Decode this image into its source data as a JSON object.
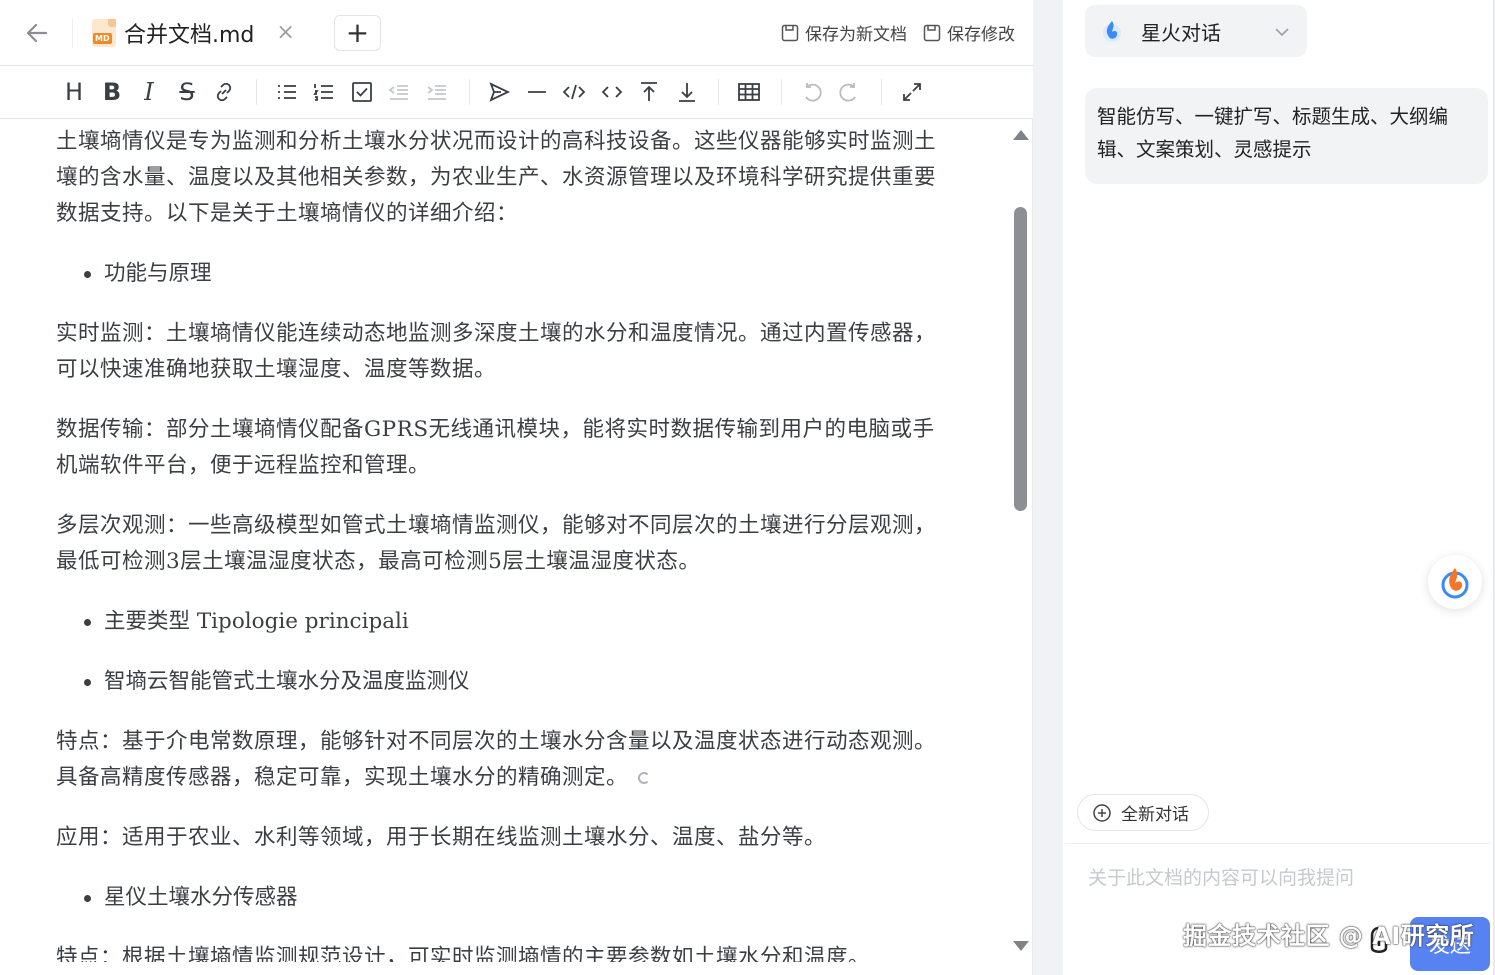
{
  "tabbar": {
    "file_name": "合并文档.md",
    "md_badge": "MD",
    "close_glyph": "×",
    "add_glyph": "+",
    "save_as_new": "保存为新文档",
    "save_changes": "保存修改"
  },
  "toolbar": {
    "heading": "H",
    "bold": "B",
    "italic": "I",
    "strike": "S",
    "buttons": [
      "heading",
      "bold",
      "italic",
      "strikethrough",
      "link",
      "unordered-list",
      "ordered-list",
      "task-list",
      "outdent",
      "indent",
      "quote",
      "horizontal-rule",
      "code-block",
      "inline-code",
      "to-top",
      "to-bottom",
      "table",
      "undo",
      "redo",
      "fullscreen"
    ]
  },
  "content": {
    "p1": "土壤墒情仪是专为监测和分析土壤水分状况而设计的高科技设备。这些仪器能够实时监测土壤的含水量、温度以及其他相关参数，为农业生产、水资源管理以及环境科学研究提供重要数据支持。以下是关于土壤墒情仪的详细介绍：",
    "b1": "功能与原理",
    "p2": "实时监测：土壤墒情仪能连续动态地监测多深度土壤的水分和温度情况。通过内置传感器，可以快速准确地获取土壤湿度、温度等数据。",
    "p3": "数据传输：部分土壤墒情仪配备GPRS无线通讯模块，能将实时数据传输到用户的电脑或手机端软件平台，便于远程监控和管理。",
    "p4": "多层次观测：一些高级模型如管式土壤墒情监测仪，能够对不同层次的土壤进行分层观测，最低可检测3层土壤温湿度状态，最高可检测5层土壤温湿度状态。",
    "b2": "主要类型 Tipologie principali",
    "b3": "智墒云智能管式土壤水分及温度监测仪",
    "p5": "特点：基于介电常数原理，能够针对不同层次的土壤水分含量以及温度状态进行动态观测。具备高精度传感器，稳定可靠，实现土壤水分的精确测定。",
    "p6": "应用：适用于农业、水利等领域，用于长期在线监测土壤水分、温度、盐分等。",
    "b4": "星仪土壤水分传感器",
    "p7": "特点：根据土壤墒情监测规范设计，可实时监测墒情的主要参数如土壤水分和温度。"
  },
  "chat": {
    "model_name": "星火对话",
    "hint": "智能仿写、一键扩写、标题生成、大纲编辑、文案策划、灵感提示",
    "new_chat": "全新对话",
    "input_placeholder": "关于此文档的内容可以向我提问",
    "send": "发送",
    "watermark": "掘金技术社区 @ AI研究所"
  },
  "colors": {
    "accent": "#3a6df0",
    "panel_bg": "#f2f3f5",
    "text": "#3b3f44"
  },
  "icons": [
    "back-arrow-icon",
    "md-file-icon",
    "close-icon",
    "plus-icon",
    "save-icon",
    "spark-logo-icon",
    "chevron-down-icon",
    "add-circle-icon",
    "paperclip-icon"
  ]
}
